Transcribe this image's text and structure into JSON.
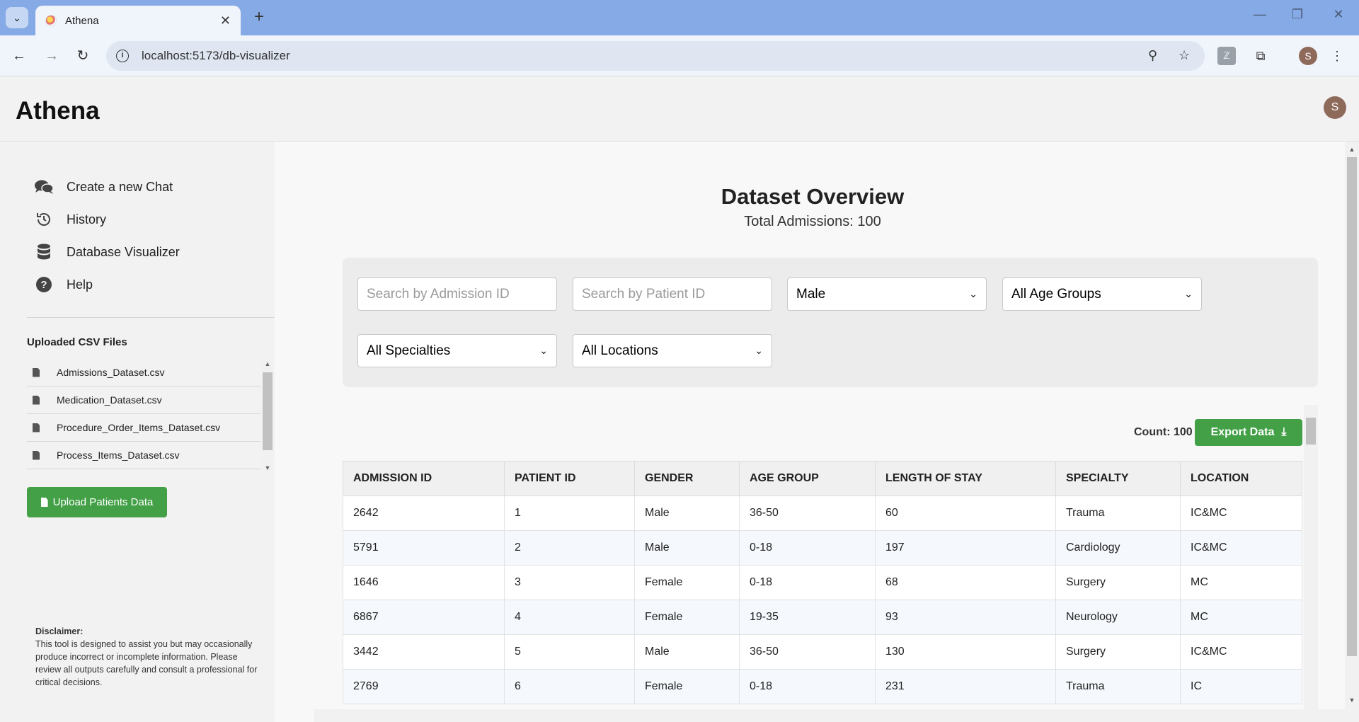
{
  "browser": {
    "tab_title": "Athena",
    "url": "localhost:5173/db-visualizer",
    "profile_initial": "S"
  },
  "app": {
    "title": "Athena",
    "user_initial": "S"
  },
  "sidebar": {
    "nav": [
      {
        "label": "Create a new Chat",
        "icon": "chat-bubbles-icon"
      },
      {
        "label": "History",
        "icon": "history-icon"
      },
      {
        "label": "Database Visualizer",
        "icon": "database-icon"
      },
      {
        "label": "Help",
        "icon": "help-icon"
      }
    ],
    "csv_heading": "Uploaded CSV Files",
    "csv_files": [
      "Admissions_Dataset.csv",
      "Medication_Dataset.csv",
      "Procedure_Order_Items_Dataset.csv",
      "Process_Items_Dataset.csv"
    ],
    "upload_label": "Upload Patients Data",
    "disclaimer_title": "Disclaimer:",
    "disclaimer_text": "This tool is designed to assist you but may occasionally produce incorrect or incomplete information. Please review all outputs carefully and consult a professional for critical decisions."
  },
  "main": {
    "title": "Dataset Overview",
    "subtitle": "Total Admissions: 100",
    "filters": {
      "admission_placeholder": "Search by Admission ID",
      "patient_placeholder": "Search by Patient ID",
      "gender": "Male",
      "age_group": "All Age Groups",
      "specialty": "All Specialties",
      "location": "All Locations"
    },
    "count_label": "Count: 100",
    "export_label": "Export Data",
    "table": {
      "headers": [
        "ADMISSION ID",
        "PATIENT ID",
        "GENDER",
        "AGE GROUP",
        "LENGTH OF STAY",
        "SPECIALTY",
        "LOCATION"
      ],
      "rows": [
        [
          "2642",
          "1",
          "Male",
          "36-50",
          "60",
          "Trauma",
          "IC&MC"
        ],
        [
          "5791",
          "2",
          "Male",
          "0-18",
          "197",
          "Cardiology",
          "IC&MC"
        ],
        [
          "1646",
          "3",
          "Female",
          "0-18",
          "68",
          "Surgery",
          "MC"
        ],
        [
          "6867",
          "4",
          "Female",
          "19-35",
          "93",
          "Neurology",
          "MC"
        ],
        [
          "3442",
          "5",
          "Male",
          "36-50",
          "130",
          "Surgery",
          "IC&MC"
        ],
        [
          "2769",
          "6",
          "Female",
          "0-18",
          "231",
          "Trauma",
          "IC"
        ]
      ]
    }
  },
  "colors": {
    "tabbar": "#86aae6",
    "accent_green": "#43a047"
  }
}
